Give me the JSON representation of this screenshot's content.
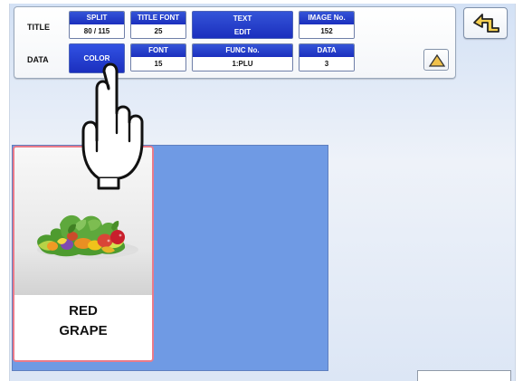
{
  "toolbar": {
    "title_label": "TITLE",
    "data_label": "DATA",
    "split": {
      "label": "SPLIT",
      "value": "80 / 115"
    },
    "title_font": {
      "label": "TITLE FONT",
      "value": "25"
    },
    "text_edit": {
      "line1": "TEXT",
      "line2": "EDIT"
    },
    "image_no": {
      "label": "IMAGE No.",
      "value": "152"
    },
    "color": {
      "label": "COLOR"
    },
    "font": {
      "label": "FONT",
      "value": "15"
    },
    "func_no": {
      "label": "FUNC No.",
      "value": "1:PLU"
    },
    "data": {
      "label": "DATA",
      "value": "3"
    }
  },
  "preview": {
    "item_name_line1": "RED",
    "item_name_line2": "GRAPE",
    "image_subject": "mixed vegetables"
  },
  "icons": {
    "back": "back-arrow-icon",
    "up": "up-triangle-icon",
    "pointer": "pointing-hand-icon"
  },
  "colors": {
    "blue_header": "#1b2fbe",
    "panel": "#6f9ae4",
    "tile_border": "#ea7b8a",
    "up_triangle": "#f0c14b"
  }
}
